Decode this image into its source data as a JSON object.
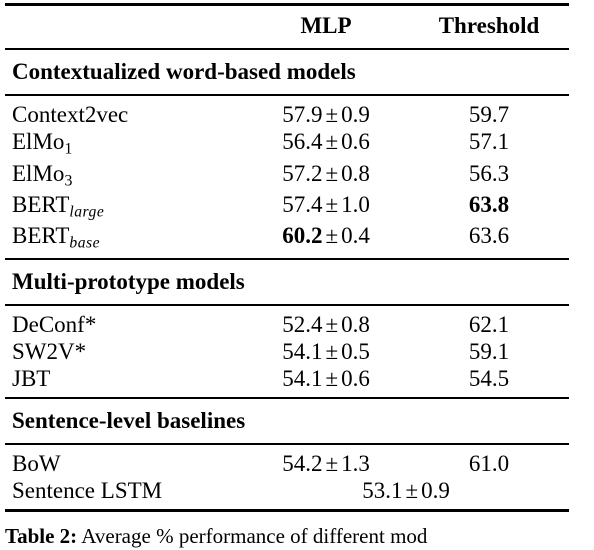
{
  "table": {
    "columns": [
      {
        "key": "label",
        "header": ""
      },
      {
        "key": "mlp",
        "header": "MLP"
      },
      {
        "key": "threshold",
        "header": "Threshold"
      }
    ],
    "sections": [
      {
        "title": "Contextualized word-based models",
        "rows": [
          {
            "label": "Context2vec",
            "label_base": "Context2vec",
            "mlp_mean": "57.9",
            "mlp_pm": "±",
            "mlp_std": "0.9",
            "mlp_bold": false,
            "threshold": "59.7",
            "threshold_bold": false
          },
          {
            "label": "ElMo1",
            "label_base": "ElMo",
            "label_sub": "1",
            "label_sub_style": "upright",
            "mlp_mean": "56.4",
            "mlp_pm": "±",
            "mlp_std": "0.6",
            "mlp_bold": false,
            "threshold": "57.1",
            "threshold_bold": false
          },
          {
            "label": "ElMo3",
            "label_base": "ElMo",
            "label_sub": "3",
            "label_sub_style": "upright",
            "mlp_mean": "57.2",
            "mlp_pm": "±",
            "mlp_std": "0.8",
            "mlp_bold": false,
            "threshold": "56.3",
            "threshold_bold": false
          },
          {
            "label": "BERTlarge",
            "label_base": "BERT",
            "label_sub": "large",
            "label_sub_style": "italic",
            "mlp_mean": "57.4",
            "mlp_pm": "±",
            "mlp_std": "1.0",
            "mlp_bold": false,
            "threshold": "63.8",
            "threshold_bold": true
          },
          {
            "label": "BERTbase",
            "label_base": "BERT",
            "label_sub": "base",
            "label_sub_style": "italic",
            "mlp_mean": "60.2",
            "mlp_pm": "±",
            "mlp_std": "0.4",
            "mlp_bold": true,
            "threshold": "63.6",
            "threshold_bold": false
          }
        ]
      },
      {
        "title": "Multi-prototype models",
        "rows": [
          {
            "label": "DeConf*",
            "label_base": "DeConf*",
            "mlp_mean": "52.4",
            "mlp_pm": "±",
            "mlp_std": "0.8",
            "mlp_bold": false,
            "threshold": "62.1",
            "threshold_bold": false
          },
          {
            "label": "SW2V*",
            "label_base": "SW2V*",
            "mlp_mean": "54.1",
            "mlp_pm": "±",
            "mlp_std": "0.5",
            "mlp_bold": false,
            "threshold": "59.1",
            "threshold_bold": false
          },
          {
            "label": "JBT",
            "label_base": "JBT",
            "mlp_mean": "54.1",
            "mlp_pm": "±",
            "mlp_std": "0.6",
            "mlp_bold": false,
            "threshold": "54.5",
            "threshold_bold": false
          }
        ]
      },
      {
        "title": "Sentence-level baselines",
        "rows": [
          {
            "label": "BoW",
            "label_base": "BoW",
            "mlp_mean": "54.2",
            "mlp_pm": "±",
            "mlp_std": "1.3",
            "mlp_bold": false,
            "threshold": "61.0",
            "threshold_bold": false
          },
          {
            "label": "Sentence LSTM",
            "label_base": "Sentence LSTM",
            "spans_columns": true,
            "span_mean": "53.1",
            "span_pm": "±",
            "span_std": "0.9"
          }
        ]
      }
    ]
  },
  "caption": {
    "label": "Table 2:",
    "text": " Average % performance of different mod"
  }
}
